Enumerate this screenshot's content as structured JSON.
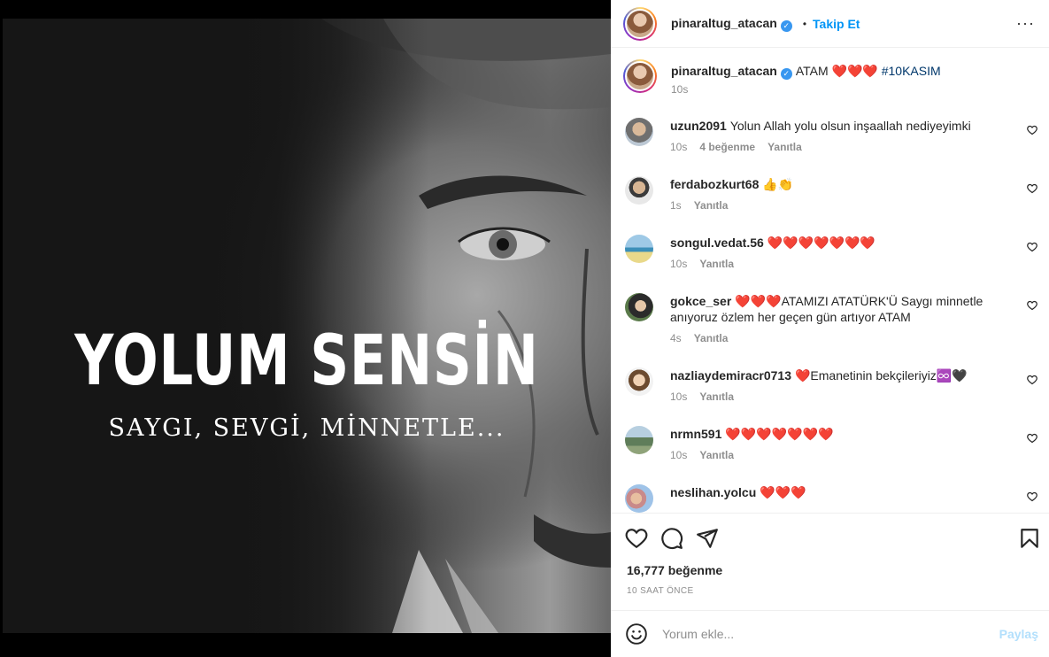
{
  "post": {
    "headline": "YOLUM SENSİN",
    "subheadline": "SAYGI, SEVGİ, MİNNETLE..."
  },
  "header": {
    "username": "pinaraltug_atacan",
    "dot": "•",
    "follow_label": "Takip Et",
    "more_label": "···"
  },
  "caption": {
    "username": "pinaraltug_atacan",
    "text": "ATAM ❤️❤️❤️",
    "hashtag": "#10KASIM",
    "time": "10s"
  },
  "comments": [
    {
      "username": "uzun2091",
      "text": "Yolun Allah yolu olsun inşaallah nediyeyimki",
      "time": "10s",
      "likes": "4 beğenme",
      "reply": "Yanıtla"
    },
    {
      "username": "ferdabozkurt68",
      "text": "👍👏",
      "time": "1s",
      "likes": "",
      "reply": "Yanıtla"
    },
    {
      "username": "songul.vedat.56",
      "text": "❤️❤️❤️❤️❤️❤️❤️",
      "time": "10s",
      "likes": "",
      "reply": "Yanıtla"
    },
    {
      "username": "gokce_ser",
      "text": "❤️❤️❤️ATAMIZI ATATÜRK'Ü Saygı minnetle anıyoruz özlem her geçen gün artıyor ATAM",
      "time": "4s",
      "likes": "",
      "reply": "Yanıtla"
    },
    {
      "username": "nazliaydemiracr0713",
      "text": "❤️Emanetinin bekçileriyiz♾️🖤",
      "time": "10s",
      "likes": "",
      "reply": "Yanıtla"
    },
    {
      "username": "nrmn591",
      "text": "❤️❤️❤️❤️❤️❤️❤️",
      "time": "10s",
      "likes": "",
      "reply": "Yanıtla"
    },
    {
      "username": "neslihan.yolcu",
      "text": "❤️❤️❤️",
      "time": "",
      "likes": "",
      "reply": ""
    }
  ],
  "actions": {
    "likes_count": "16,777 beğenme",
    "time_ago": "10 SAAT ÖNCE"
  },
  "composer": {
    "placeholder": "Yorum ekle...",
    "share_label": "Paylaş"
  },
  "colors": {
    "link": "#0095f6",
    "share_disabled": "#b2dffc",
    "verified": "#3897f0"
  }
}
